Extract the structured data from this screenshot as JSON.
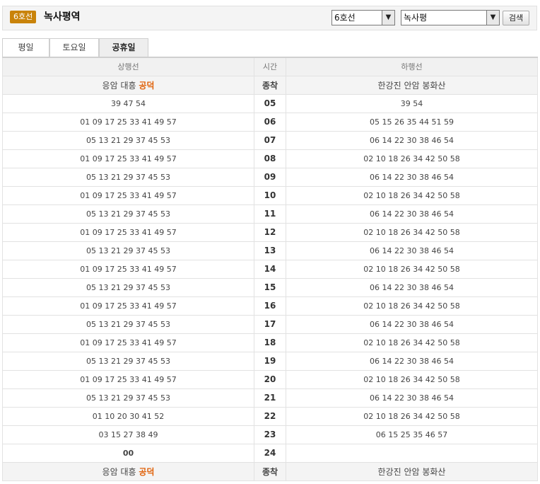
{
  "header": {
    "line_badge": "6호선",
    "station_title": "녹사평역",
    "line_select_value": "6호선",
    "station_select_value": "녹사평",
    "search_label": "검색"
  },
  "tabs": [
    {
      "label": "평일",
      "active": false
    },
    {
      "label": "토요일",
      "active": false
    },
    {
      "label": "공휴일",
      "active": true
    }
  ],
  "table": {
    "headers": {
      "up": "상행선",
      "time": "시간",
      "down": "하행선"
    },
    "terminal": {
      "up_prefix": "응암 대흥 ",
      "up_highlight": "공덕",
      "time": "종착",
      "down": "한강진 안암 봉화산"
    },
    "rows": [
      {
        "hour": "05",
        "up": "39 47 54",
        "down": "39 54"
      },
      {
        "hour": "06",
        "up": "01 09 17 25 33 41 49 57",
        "down": "05 15 26 35 44 51 59"
      },
      {
        "hour": "07",
        "up": "05 13 21 29 37 45 53",
        "down": "06 14 22 30 38 46 54"
      },
      {
        "hour": "08",
        "up": "01 09 17 25 33 41 49 57",
        "down": "02 10 18 26 34 42 50 58"
      },
      {
        "hour": "09",
        "up": "05 13 21 29 37 45 53",
        "down": "06 14 22 30 38 46 54"
      },
      {
        "hour": "10",
        "up": "01 09 17 25 33 41 49 57",
        "down": "02 10 18 26 34 42 50 58"
      },
      {
        "hour": "11",
        "up": "05 13 21 29 37 45 53",
        "down": "06 14 22 30 38 46 54"
      },
      {
        "hour": "12",
        "up": "01 09 17 25 33 41 49 57",
        "down": "02 10 18 26 34 42 50 58"
      },
      {
        "hour": "13",
        "up": "05 13 21 29 37 45 53",
        "down": "06 14 22 30 38 46 54"
      },
      {
        "hour": "14",
        "up": "01 09 17 25 33 41 49 57",
        "down": "02 10 18 26 34 42 50 58"
      },
      {
        "hour": "15",
        "up": "05 13 21 29 37 45 53",
        "down": "06 14 22 30 38 46 54"
      },
      {
        "hour": "16",
        "up": "01 09 17 25 33 41 49 57",
        "down": "02 10 18 26 34 42 50 58"
      },
      {
        "hour": "17",
        "up": "05 13 21 29 37 45 53",
        "down": "06 14 22 30 38 46 54"
      },
      {
        "hour": "18",
        "up": "01 09 17 25 33 41 49 57",
        "down": "02 10 18 26 34 42 50 58"
      },
      {
        "hour": "19",
        "up": "05 13 21 29 37 45 53",
        "down": "06 14 22 30 38 46 54"
      },
      {
        "hour": "20",
        "up": "01 09 17 25 33 41 49 57",
        "down": "02 10 18 26 34 42 50 58"
      },
      {
        "hour": "21",
        "up": "05 13 21 29 37 45 53",
        "down": "06 14 22 30 38 46 54"
      },
      {
        "hour": "22",
        "up": "01 10 20 30 41 52",
        "down": "02 10 18 26 34 42 50 58"
      },
      {
        "hour": "23",
        "up": "03 15 27 38 49",
        "down": "06 15 25 35 46 57"
      },
      {
        "hour": "24",
        "up": "00",
        "down": "",
        "up_highlight": true
      }
    ]
  },
  "colors": {
    "badge": "#c9830a",
    "highlight": "#e0620b"
  }
}
